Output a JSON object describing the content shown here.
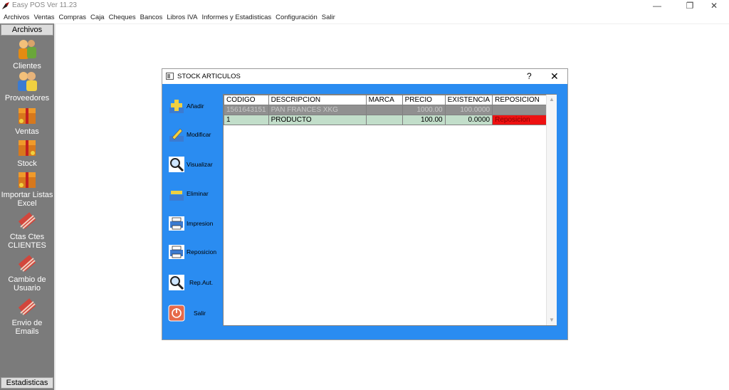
{
  "window": {
    "title": "Easy POS Ver 11.23",
    "controls": [
      "minimize",
      "restore",
      "close"
    ]
  },
  "menu": [
    "Archivos",
    "Ventas",
    "Compras",
    "Caja",
    "Cheques",
    "Bancos",
    "Libros IVA",
    "Informes y Estadisticas",
    "Configuración",
    "Salir"
  ],
  "sidebar": {
    "header": "Archivos",
    "footer": "Estadisticas",
    "items": [
      {
        "label": "Clientes",
        "icon": "clients-icon"
      },
      {
        "label": "Proveedores",
        "icon": "suppliers-icon"
      },
      {
        "label": "Ventas",
        "icon": "sales-icon"
      },
      {
        "label": "Stock",
        "icon": "stock-icon"
      },
      {
        "label": "Importar Listas Excel",
        "icon": "import-excel-icon"
      },
      {
        "label": "Ctas Ctes CLIENTES",
        "icon": "accounts-icon"
      },
      {
        "label": "Cambio de Usuario",
        "icon": "change-user-icon"
      },
      {
        "label": "Envio de Emails",
        "icon": "email-icon"
      }
    ]
  },
  "dialog": {
    "title": "STOCK ARTICULOS",
    "help": "?",
    "close": "✕",
    "buttons": [
      {
        "label": "Añadir",
        "icon": "add-icon"
      },
      {
        "label": "Modificar",
        "icon": "edit-icon"
      },
      {
        "label": "Visualizar",
        "icon": "view-icon"
      },
      {
        "label": "Eliminar",
        "icon": "delete-icon"
      },
      {
        "label": "Impresion",
        "icon": "printer-icon"
      },
      {
        "label": "Reposicion",
        "icon": "printer-icon"
      },
      {
        "label": "Rep.Aut.",
        "icon": "search-icon"
      },
      {
        "label": "Salir",
        "icon": "power-icon"
      }
    ],
    "table": {
      "columns": [
        "CODIGO",
        "DESCRIPCION",
        "MARCA",
        "PRECIO",
        "EXISTENCIA",
        "REPOSICION"
      ],
      "rows": [
        [
          "1561643151",
          "PAN FRANCES XKG",
          "",
          "1000.00",
          "100.0000",
          ""
        ],
        [
          "1",
          "PRODUCTO",
          "",
          "100.00",
          "0.0000",
          "Reposicion"
        ]
      ]
    }
  },
  "colors": {
    "dialog_bg": "#2a8cf1",
    "sidebar_bg": "#7b7b7b",
    "row_selected": "#909090",
    "row_normal": "#c2deca",
    "reposicion_alert": "#ee1111"
  }
}
